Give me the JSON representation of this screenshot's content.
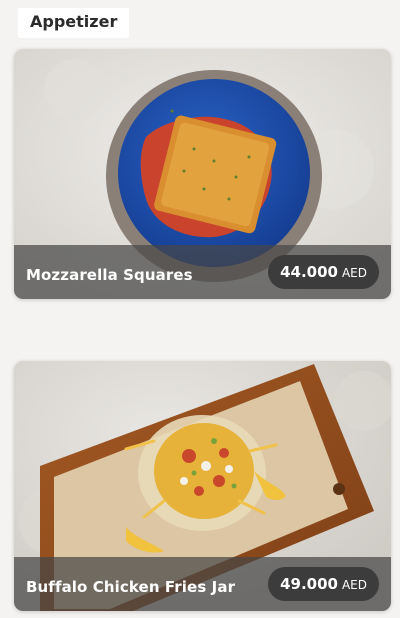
{
  "section": {
    "title": "Appetizer"
  },
  "items": [
    {
      "name": "Mozzarella Squares",
      "price": "44.000",
      "currency": "AED"
    },
    {
      "name": "Buffalo Chicken Fries Jar",
      "price": "49.000",
      "currency": "AED"
    }
  ]
}
